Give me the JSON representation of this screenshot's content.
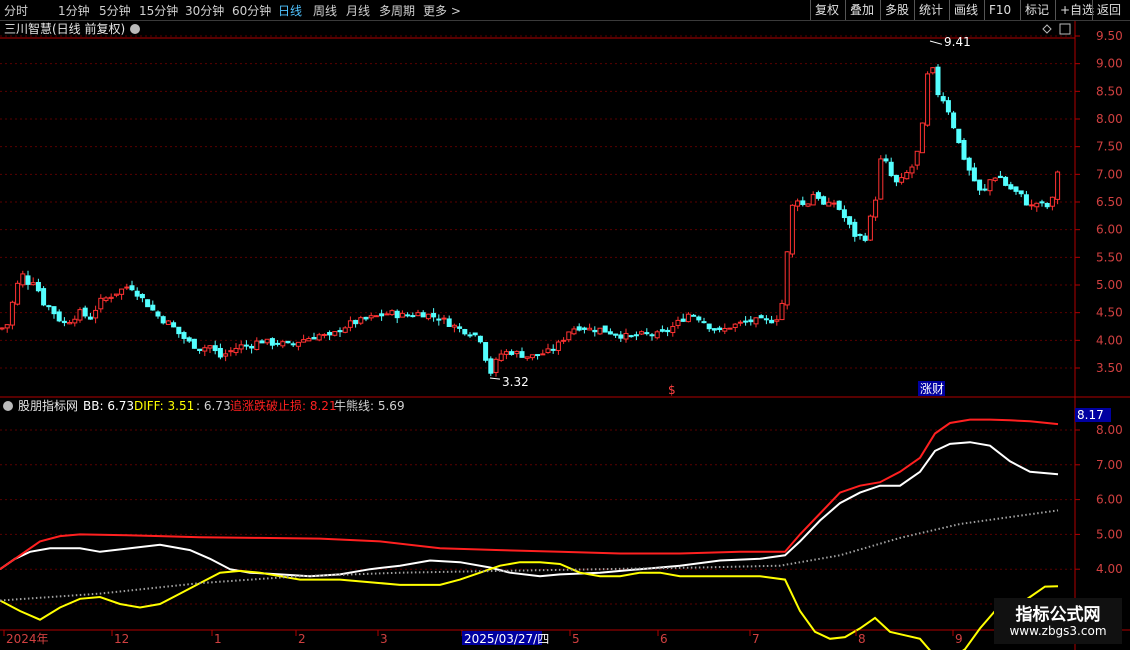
{
  "toolbar": {
    "periods": [
      "分时",
      "1分钟",
      "5分钟",
      "15分钟",
      "30分钟",
      "60分钟",
      "日线",
      "周线",
      "月线",
      "多周期"
    ],
    "active_period": "日线",
    "more_label": "更多 >",
    "right_buttons": [
      "复权",
      "叠加",
      "多股",
      "统计",
      "画线",
      "F10",
      "+自选",
      "返回"
    ],
    "mark_label": "标记"
  },
  "stock": {
    "title": "三川智慧(日线 前复权)"
  },
  "tags": {
    "dollar": "$",
    "event": "涨财"
  },
  "indicator": {
    "name": "股朋指标网",
    "bb_label": "BB: 6.73",
    "diff_label": "DIFF: 3.51",
    "third_label": ": 6.73",
    "stop_label": "追涨跌破止损: 8.21",
    "bull_label": "牛熊线: 5.69",
    "current_tag": "8.17"
  },
  "watermark": {
    "title": "指标公式网",
    "url": "www.zbgs3.com"
  },
  "colors": {
    "up": "#ff3232",
    "down": "#54ffff",
    "bb": "#ffffff",
    "diff": "#ffff00",
    "stop": "#ff2020",
    "bull": "#a0a0a0",
    "axis": "#b00000",
    "grid": "#5a0000",
    "active": "#4fc3ff",
    "tag_bg": "#0000a0"
  },
  "chart_data": [
    {
      "type": "candlestick",
      "title": "三川智慧(日线 前复权)",
      "y_ticks": [
        3.5,
        4.0,
        4.5,
        5.0,
        5.5,
        6.0,
        6.5,
        7.0,
        7.5,
        8.0,
        8.5,
        9.0,
        9.5
      ],
      "ylim": [
        3.05,
        9.75
      ],
      "x_ticks": [
        "2024年",
        "12",
        "1",
        "2",
        "3",
        "2025/03/27/四",
        "5",
        "6",
        "7",
        "8",
        "9"
      ],
      "annotations": [
        {
          "label": "9.41",
          "value": 9.41
        },
        {
          "label": "3.32",
          "value": 3.32
        }
      ],
      "close_path": [
        [
          0,
          4.2
        ],
        [
          8,
          4.3
        ],
        [
          15,
          4.9
        ],
        [
          22,
          5.2
        ],
        [
          28,
          5.05
        ],
        [
          35,
          5.1
        ],
        [
          42,
          4.7
        ],
        [
          50,
          4.6
        ],
        [
          58,
          4.4
        ],
        [
          65,
          4.3
        ],
        [
          72,
          4.4
        ],
        [
          80,
          4.5
        ],
        [
          90,
          4.4
        ],
        [
          100,
          4.7
        ],
        [
          110,
          4.8
        ],
        [
          120,
          4.9
        ],
        [
          130,
          5.0
        ],
        [
          140,
          4.8
        ],
        [
          150,
          4.6
        ],
        [
          160,
          4.4
        ],
        [
          170,
          4.3
        ],
        [
          180,
          4.1
        ],
        [
          190,
          3.95
        ],
        [
          200,
          3.85
        ],
        [
          210,
          3.9
        ],
        [
          220,
          3.7
        ],
        [
          230,
          3.8
        ],
        [
          240,
          3.9
        ],
        [
          250,
          3.9
        ],
        [
          260,
          4.0
        ],
        [
          270,
          3.95
        ],
        [
          280,
          3.95
        ],
        [
          290,
          3.9
        ],
        [
          300,
          4.0
        ],
        [
          310,
          4.05
        ],
        [
          320,
          4.1
        ],
        [
          330,
          4.05
        ],
        [
          340,
          4.2
        ],
        [
          350,
          4.3
        ],
        [
          360,
          4.35
        ],
        [
          370,
          4.4
        ],
        [
          380,
          4.45
        ],
        [
          390,
          4.5
        ],
        [
          400,
          4.45
        ],
        [
          410,
          4.45
        ],
        [
          420,
          4.5
        ],
        [
          430,
          4.45
        ],
        [
          440,
          4.4
        ],
        [
          450,
          4.3
        ],
        [
          460,
          4.2
        ],
        [
          470,
          4.15
        ],
        [
          480,
          4.05
        ],
        [
          490,
          3.4
        ],
        [
          500,
          3.75
        ],
        [
          510,
          3.8
        ],
        [
          520,
          3.75
        ],
        [
          530,
          3.7
        ],
        [
          540,
          3.75
        ],
        [
          550,
          3.8
        ],
        [
          560,
          3.95
        ],
        [
          570,
          4.2
        ],
        [
          580,
          4.25
        ],
        [
          590,
          4.2
        ],
        [
          600,
          4.2
        ],
        [
          610,
          4.15
        ],
        [
          620,
          4.1
        ],
        [
          630,
          4.05
        ],
        [
          640,
          4.1
        ],
        [
          650,
          4.1
        ],
        [
          660,
          4.1
        ],
        [
          670,
          4.2
        ],
        [
          680,
          4.35
        ],
        [
          690,
          4.5
        ],
        [
          700,
          4.4
        ],
        [
          710,
          4.25
        ],
        [
          720,
          4.15
        ],
        [
          730,
          4.25
        ],
        [
          740,
          4.3
        ],
        [
          750,
          4.35
        ],
        [
          760,
          4.35
        ],
        [
          770,
          4.35
        ],
        [
          780,
          4.45
        ],
        [
          785,
          5.0
        ],
        [
          790,
          6.3
        ],
        [
          796,
          6.6
        ],
        [
          805,
          6.4
        ],
        [
          815,
          6.7
        ],
        [
          825,
          6.4
        ],
        [
          835,
          6.5
        ],
        [
          845,
          6.2
        ],
        [
          855,
          5.9
        ],
        [
          865,
          5.85
        ],
        [
          875,
          6.5
        ],
        [
          882,
          7.4
        ],
        [
          890,
          7.0
        ],
        [
          898,
          6.8
        ],
        [
          906,
          7.0
        ],
        [
          915,
          7.2
        ],
        [
          922,
          7.8
        ],
        [
          930,
          9.2
        ],
        [
          936,
          8.5
        ],
        [
          942,
          8.4
        ],
        [
          950,
          8.1
        ],
        [
          958,
          7.6
        ],
        [
          966,
          7.2
        ],
        [
          974,
          6.9
        ],
        [
          982,
          6.6
        ],
        [
          990,
          6.9
        ],
        [
          998,
          7.0
        ],
        [
          1006,
          6.8
        ],
        [
          1014,
          6.7
        ],
        [
          1022,
          6.6
        ],
        [
          1030,
          6.4
        ],
        [
          1038,
          6.5
        ],
        [
          1046,
          6.4
        ],
        [
          1052,
          6.5
        ],
        [
          1058,
          7.1
        ]
      ]
    },
    {
      "type": "line",
      "y_ticks": [
        3.0,
        4.0,
        5.0,
        6.0,
        7.0,
        8.0
      ],
      "ylim": [
        1.98,
        8.62
      ],
      "series": [
        {
          "name": "BB",
          "color": "#ffffff",
          "values": [
            [
              0,
              4.0
            ],
            [
              15,
              4.3
            ],
            [
              30,
              4.5
            ],
            [
              50,
              4.6
            ],
            [
              80,
              4.6
            ],
            [
              100,
              4.5
            ],
            [
              130,
              4.6
            ],
            [
              160,
              4.7
            ],
            [
              190,
              4.55
            ],
            [
              210,
              4.3
            ],
            [
              230,
              4.0
            ],
            [
              250,
              3.9
            ],
            [
              280,
              3.85
            ],
            [
              310,
              3.8
            ],
            [
              340,
              3.85
            ],
            [
              370,
              4.0
            ],
            [
              400,
              4.1
            ],
            [
              430,
              4.25
            ],
            [
              460,
              4.2
            ],
            [
              490,
              4.05
            ],
            [
              510,
              3.9
            ],
            [
              540,
              3.8
            ],
            [
              560,
              3.85
            ],
            [
              600,
              3.9
            ],
            [
              640,
              4.0
            ],
            [
              680,
              4.1
            ],
            [
              720,
              4.25
            ],
            [
              760,
              4.3
            ],
            [
              785,
              4.4
            ],
            [
              800,
              4.8
            ],
            [
              820,
              5.4
            ],
            [
              840,
              5.9
            ],
            [
              860,
              6.2
            ],
            [
              880,
              6.4
            ],
            [
              900,
              6.4
            ],
            [
              920,
              6.8
            ],
            [
              935,
              7.4
            ],
            [
              950,
              7.6
            ],
            [
              970,
              7.65
            ],
            [
              990,
              7.55
            ],
            [
              1010,
              7.1
            ],
            [
              1030,
              6.8
            ],
            [
              1058,
              6.73
            ]
          ]
        },
        {
          "name": "DIFF",
          "color": "#ffff00",
          "values": [
            [
              0,
              3.1
            ],
            [
              20,
              2.8
            ],
            [
              40,
              2.55
            ],
            [
              60,
              2.9
            ],
            [
              80,
              3.15
            ],
            [
              100,
              3.2
            ],
            [
              120,
              3.0
            ],
            [
              140,
              2.9
            ],
            [
              160,
              3.0
            ],
            [
              180,
              3.3
            ],
            [
              200,
              3.6
            ],
            [
              220,
              3.9
            ],
            [
              240,
              3.95
            ],
            [
              260,
              3.9
            ],
            [
              280,
              3.8
            ],
            [
              300,
              3.7
            ],
            [
              320,
              3.7
            ],
            [
              340,
              3.7
            ],
            [
              360,
              3.65
            ],
            [
              380,
              3.6
            ],
            [
              400,
              3.55
            ],
            [
              420,
              3.55
            ],
            [
              440,
              3.55
            ],
            [
              460,
              3.7
            ],
            [
              480,
              3.9
            ],
            [
              500,
              4.1
            ],
            [
              520,
              4.2
            ],
            [
              540,
              4.2
            ],
            [
              560,
              4.15
            ],
            [
              580,
              3.9
            ],
            [
              600,
              3.8
            ],
            [
              620,
              3.8
            ],
            [
              640,
              3.9
            ],
            [
              660,
              3.9
            ],
            [
              680,
              3.8
            ],
            [
              700,
              3.8
            ],
            [
              720,
              3.8
            ],
            [
              740,
              3.8
            ],
            [
              760,
              3.8
            ],
            [
              785,
              3.7
            ],
            [
              800,
              2.8
            ],
            [
              815,
              2.2
            ],
            [
              830,
              2.0
            ],
            [
              845,
              2.05
            ],
            [
              860,
              2.3
            ],
            [
              875,
              2.6
            ],
            [
              890,
              2.2
            ],
            [
              905,
              2.1
            ],
            [
              920,
              2.0
            ],
            [
              935,
              1.5
            ],
            [
              950,
              1.4
            ],
            [
              965,
              1.7
            ],
            [
              980,
              2.3
            ],
            [
              995,
              2.8
            ],
            [
              1015,
              2.9
            ],
            [
              1030,
              3.2
            ],
            [
              1045,
              3.5
            ],
            [
              1058,
              3.51
            ]
          ]
        },
        {
          "name": "追涨跌破止损",
          "color": "#ff2020",
          "values": [
            [
              0,
              4.0
            ],
            [
              20,
              4.4
            ],
            [
              40,
              4.8
            ],
            [
              60,
              4.95
            ],
            [
              80,
              5.0
            ],
            [
              120,
              4.98
            ],
            [
              160,
              4.95
            ],
            [
              200,
              4.92
            ],
            [
              260,
              4.9
            ],
            [
              320,
              4.88
            ],
            [
              380,
              4.8
            ],
            [
              440,
              4.6
            ],
            [
              500,
              4.55
            ],
            [
              560,
              4.5
            ],
            [
              620,
              4.45
            ],
            [
              680,
              4.45
            ],
            [
              740,
              4.5
            ],
            [
              785,
              4.5
            ],
            [
              800,
              5.0
            ],
            [
              820,
              5.6
            ],
            [
              840,
              6.2
            ],
            [
              860,
              6.4
            ],
            [
              880,
              6.5
            ],
            [
              900,
              6.8
            ],
            [
              920,
              7.2
            ],
            [
              935,
              7.9
            ],
            [
              950,
              8.2
            ],
            [
              970,
              8.3
            ],
            [
              990,
              8.3
            ],
            [
              1010,
              8.28
            ],
            [
              1030,
              8.25
            ],
            [
              1058,
              8.17
            ]
          ]
        },
        {
          "name": "牛熊线",
          "color": "#a0a0a0",
          "dotted": true,
          "values": [
            [
              0,
              3.1
            ],
            [
              100,
              3.3
            ],
            [
              200,
              3.6
            ],
            [
              300,
              3.8
            ],
            [
              400,
              3.9
            ],
            [
              500,
              3.95
            ],
            [
              600,
              4.0
            ],
            [
              700,
              4.05
            ],
            [
              780,
              4.1
            ],
            [
              840,
              4.4
            ],
            [
              900,
              4.9
            ],
            [
              960,
              5.3
            ],
            [
              1058,
              5.69
            ]
          ]
        }
      ]
    }
  ]
}
